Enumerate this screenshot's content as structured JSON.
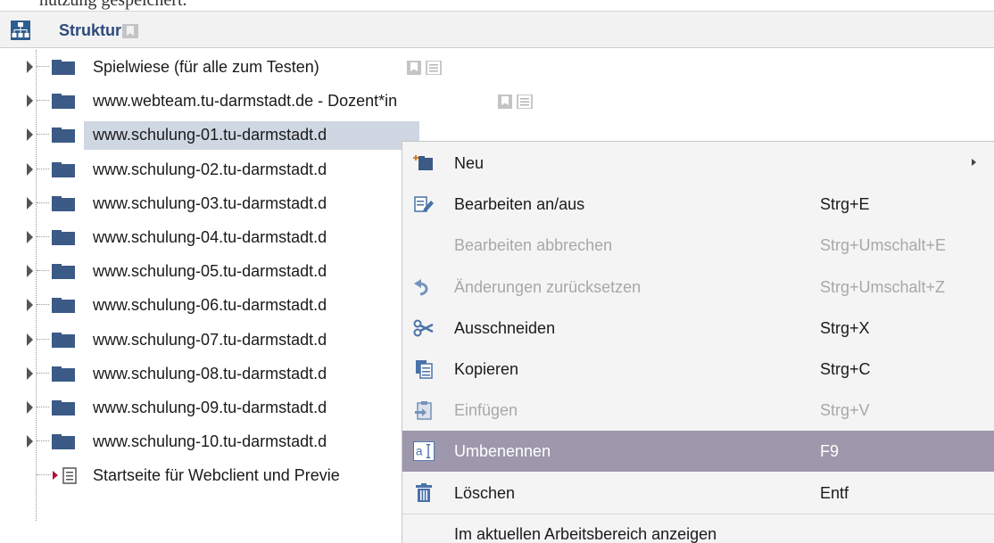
{
  "top_fragment": "nutzung gespeichert.",
  "panel": {
    "title": "Struktur"
  },
  "tree": {
    "items": [
      {
        "label": "Spielwiese (für alle zum Testen)",
        "type": "folder"
      },
      {
        "label": "www.webteam.tu-darmstadt.de - Dozent*in",
        "type": "folder"
      },
      {
        "label": "www.schulung-01.tu-darmstadt.d",
        "type": "folder",
        "selected": true
      },
      {
        "label": "www.schulung-02.tu-darmstadt.d",
        "type": "folder"
      },
      {
        "label": "www.schulung-03.tu-darmstadt.d",
        "type": "folder"
      },
      {
        "label": "www.schulung-04.tu-darmstadt.d",
        "type": "folder"
      },
      {
        "label": "www.schulung-05.tu-darmstadt.d",
        "type": "folder"
      },
      {
        "label": "www.schulung-06.tu-darmstadt.d",
        "type": "folder"
      },
      {
        "label": "www.schulung-07.tu-darmstadt.d",
        "type": "folder"
      },
      {
        "label": "www.schulung-08.tu-darmstadt.d",
        "type": "folder"
      },
      {
        "label": "www.schulung-09.tu-darmstadt.d",
        "type": "folder"
      },
      {
        "label": "www.schulung-10.tu-darmstadt.d",
        "type": "folder"
      },
      {
        "label": "Startseite für Webclient und Previe",
        "type": "page"
      }
    ]
  },
  "context_menu": {
    "items": [
      {
        "label": "Neu",
        "shortcut": "",
        "icon": "new-icon",
        "disabled": false,
        "submenu": true
      },
      {
        "label": "Bearbeiten an/aus",
        "shortcut": "Strg+E",
        "icon": "edit-icon",
        "disabled": false
      },
      {
        "label": "Bearbeiten abbrechen",
        "shortcut": "Strg+Umschalt+E",
        "icon": "",
        "disabled": true
      },
      {
        "label": "Änderungen zurücksetzen",
        "shortcut": "Strg+Umschalt+Z",
        "icon": "revert-icon",
        "disabled": true
      },
      {
        "label": "Ausschneiden",
        "shortcut": "Strg+X",
        "icon": "scissors-icon",
        "disabled": false
      },
      {
        "label": "Kopieren",
        "shortcut": "Strg+C",
        "icon": "copy-icon",
        "disabled": false
      },
      {
        "label": "Einfügen",
        "shortcut": "Strg+V",
        "icon": "paste-icon",
        "disabled": true
      },
      {
        "label": "Umbenennen",
        "shortcut": "F9",
        "icon": "rename-icon",
        "disabled": false,
        "highlighted": true
      },
      {
        "label": "Löschen",
        "shortcut": "Entf",
        "icon": "trash-icon",
        "disabled": false
      },
      {
        "label": "Im aktuellen Arbeitsbereich anzeigen",
        "shortcut": "",
        "icon": "",
        "disabled": false
      }
    ]
  },
  "colors": {
    "selection": "#cfd7e3",
    "menu_highlight": "#9d98ab",
    "folder": "#3b5a86",
    "header_title": "#2d4a7a"
  }
}
